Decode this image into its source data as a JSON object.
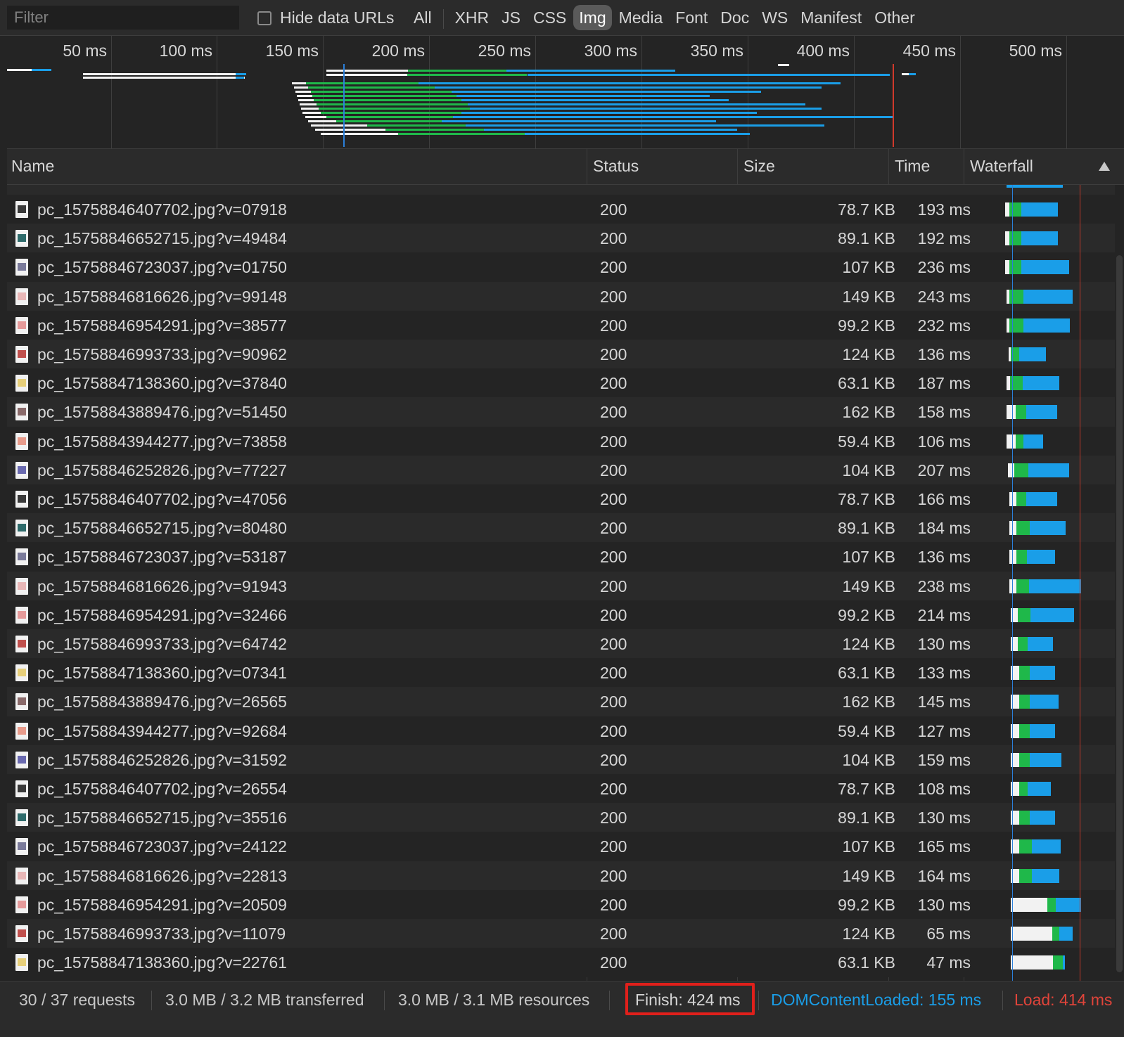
{
  "toolbar": {
    "filter_placeholder": "Filter",
    "hide_data_urls": "Hide data URLs",
    "types": [
      "All",
      "XHR",
      "JS",
      "CSS",
      "Img",
      "Media",
      "Font",
      "Doc",
      "WS",
      "Manifest",
      "Other"
    ],
    "active_type": "Img"
  },
  "overview": {
    "ticks": [
      "50 ms",
      "100 ms",
      "150 ms",
      "200 ms",
      "250 ms",
      "300 ms",
      "350 ms",
      "400 ms",
      "450 ms",
      "500 ms"
    ]
  },
  "columns": {
    "name": "Name",
    "status": "Status",
    "size": "Size",
    "time": "Time",
    "waterfall": "Waterfall"
  },
  "rows": [
    {
      "name": "pc_15758846407702.jpg?v=07918",
      "status": "200",
      "size": "78.7 KB",
      "time": "193 ms",
      "icon": "#3a3a3a"
    },
    {
      "name": "pc_15758846652715.jpg?v=49484",
      "status": "200",
      "size": "89.1 KB",
      "time": "192 ms",
      "icon": "#2e6b6b"
    },
    {
      "name": "pc_15758846723037.jpg?v=01750",
      "status": "200",
      "size": "107 KB",
      "time": "236 ms",
      "icon": "#7a7a9a"
    },
    {
      "name": "pc_15758846816626.jpg?v=99148",
      "status": "200",
      "size": "149 KB",
      "time": "243 ms",
      "icon": "#e8b6b6"
    },
    {
      "name": "pc_15758846954291.jpg?v=38577",
      "status": "200",
      "size": "99.2 KB",
      "time": "232 ms",
      "icon": "#e69a9a"
    },
    {
      "name": "pc_15758846993733.jpg?v=90962",
      "status": "200",
      "size": "124 KB",
      "time": "136 ms",
      "icon": "#c0504d"
    },
    {
      "name": "pc_15758847138360.jpg?v=37840",
      "status": "200",
      "size": "63.1 KB",
      "time": "187 ms",
      "icon": "#e7cf7a"
    },
    {
      "name": "pc_15758843889476.jpg?v=51450",
      "status": "200",
      "size": "162 KB",
      "time": "158 ms",
      "icon": "#8a6a6a"
    },
    {
      "name": "pc_15758843944277.jpg?v=73858",
      "status": "200",
      "size": "59.4 KB",
      "time": "106 ms",
      "icon": "#e89b8b"
    },
    {
      "name": "pc_15758846252826.jpg?v=77227",
      "status": "200",
      "size": "104 KB",
      "time": "207 ms",
      "icon": "#6a6ab0"
    },
    {
      "name": "pc_15758846407702.jpg?v=47056",
      "status": "200",
      "size": "78.7 KB",
      "time": "166 ms",
      "icon": "#3a3a3a"
    },
    {
      "name": "pc_15758846652715.jpg?v=80480",
      "status": "200",
      "size": "89.1 KB",
      "time": "184 ms",
      "icon": "#2e6b6b"
    },
    {
      "name": "pc_15758846723037.jpg?v=53187",
      "status": "200",
      "size": "107 KB",
      "time": "136 ms",
      "icon": "#7a7a9a"
    },
    {
      "name": "pc_15758846816626.jpg?v=91943",
      "status": "200",
      "size": "149 KB",
      "time": "238 ms",
      "icon": "#e8b6b6"
    },
    {
      "name": "pc_15758846954291.jpg?v=32466",
      "status": "200",
      "size": "99.2 KB",
      "time": "214 ms",
      "icon": "#e69a9a"
    },
    {
      "name": "pc_15758846993733.jpg?v=64742",
      "status": "200",
      "size": "124 KB",
      "time": "130 ms",
      "icon": "#c0504d"
    },
    {
      "name": "pc_15758847138360.jpg?v=07341",
      "status": "200",
      "size": "63.1 KB",
      "time": "133 ms",
      "icon": "#e7cf7a"
    },
    {
      "name": "pc_15758843889476.jpg?v=26565",
      "status": "200",
      "size": "162 KB",
      "time": "145 ms",
      "icon": "#8a6a6a"
    },
    {
      "name": "pc_15758843944277.jpg?v=92684",
      "status": "200",
      "size": "59.4 KB",
      "time": "127 ms",
      "icon": "#e89b8b"
    },
    {
      "name": "pc_15758846252826.jpg?v=31592",
      "status": "200",
      "size": "104 KB",
      "time": "159 ms",
      "icon": "#6a6ab0"
    },
    {
      "name": "pc_15758846407702.jpg?v=26554",
      "status": "200",
      "size": "78.7 KB",
      "time": "108 ms",
      "icon": "#3a3a3a"
    },
    {
      "name": "pc_15758846652715.jpg?v=35516",
      "status": "200",
      "size": "89.1 KB",
      "time": "130 ms",
      "icon": "#2e6b6b"
    },
    {
      "name": "pc_15758846723037.jpg?v=24122",
      "status": "200",
      "size": "107 KB",
      "time": "165 ms",
      "icon": "#7a7a9a"
    },
    {
      "name": "pc_15758846816626.jpg?v=22813",
      "status": "200",
      "size": "149 KB",
      "time": "164 ms",
      "icon": "#e8b6b6"
    },
    {
      "name": "pc_15758846954291.jpg?v=20509",
      "status": "200",
      "size": "99.2 KB",
      "time": "130 ms",
      "icon": "#e69a9a"
    },
    {
      "name": "pc_15758846993733.jpg?v=11079",
      "status": "200",
      "size": "124 KB",
      "time": "65 ms",
      "icon": "#c0504d"
    },
    {
      "name": "pc_15758847138360.jpg?v=22761",
      "status": "200",
      "size": "63.1 KB",
      "time": "47 ms",
      "icon": "#e7cf7a"
    }
  ],
  "status_bar": {
    "requests": "30 / 37 requests",
    "transferred": "3.0 MB / 3.2 MB transferred",
    "resources": "3.0 MB / 3.1 MB resources",
    "finish": "Finish: 424 ms",
    "dom_content_loaded": "DOMContentLoaded: 155 ms",
    "load": "Load: 414 ms"
  },
  "colors": {
    "waiting": "#1fb84a",
    "download": "#1a9ee8",
    "queue": "#f2f2f2",
    "dcl_line": "#2b7fd9",
    "load_line": "#d0392b",
    "highlight": "#e0201b"
  }
}
